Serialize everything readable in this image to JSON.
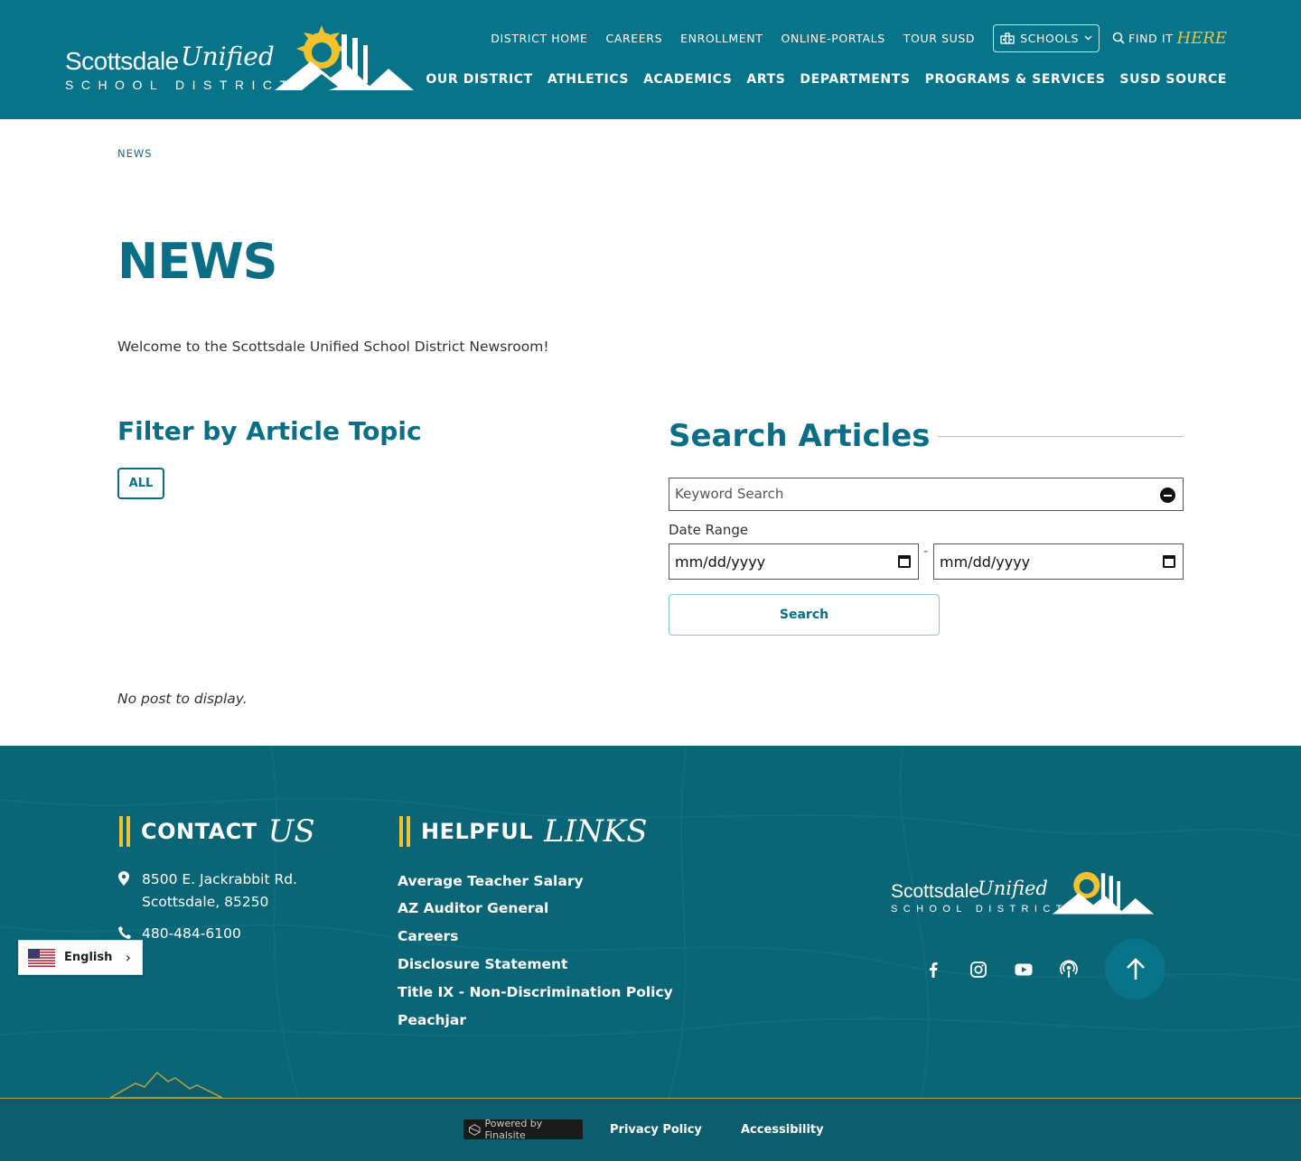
{
  "header": {
    "logo": {
      "word": "Scottsdale",
      "script": "Unified",
      "sub": "SCHOOL DISTRICT"
    },
    "utility_nav": [
      "DISTRICT HOME",
      "CAREERS",
      "ENROLLMENT",
      "ONLINE-PORTALS",
      "TOUR SUSD"
    ],
    "schools_label": "SCHOOLS",
    "find_label": "FIND IT",
    "find_here": "HERE",
    "main_nav": [
      "OUR DISTRICT",
      "ATHLETICS",
      "ACADEMICS",
      "ARTS",
      "DEPARTMENTS",
      "PROGRAMS & SERVICES",
      "SUSD SOURCE"
    ]
  },
  "breadcrumb": "NEWS",
  "page_title": "NEWS",
  "welcome": "Welcome to the Scottsdale Unified School District Newsroom!",
  "filter": {
    "heading": "Filter by Article Topic",
    "all_label": "ALL"
  },
  "search": {
    "heading": "Search Articles",
    "keyword_placeholder": "Keyword Search",
    "date_label": "Date Range",
    "date_from": "mm/dd/yyyy",
    "date_sep": "-",
    "date_to": "mm/dd/yyyy",
    "button_label": "Search"
  },
  "no_post": "No post to display.",
  "footer": {
    "contact": {
      "h1": "CONTACT",
      "h2": "US",
      "address_line1": "8500 E. Jackrabbit Rd.",
      "address_line2": "Scottsdale, 85250",
      "phone": "480-484-6100"
    },
    "links": {
      "h1": "HELPFUL",
      "h2": "LINKS",
      "items": [
        "Average Teacher Salary",
        "AZ Auditor General",
        "Careers",
        "Disclosure Statement",
        "Title IX - Non-Discrimination Policy",
        "Peachjar"
      ]
    },
    "logo": {
      "word": "Scottsdale",
      "script": "Unified",
      "sub": "SCHOOL DISTRICT"
    },
    "social_icons": [
      "facebook-icon",
      "instagram-icon",
      "youtube-icon",
      "podcast-icon"
    ]
  },
  "bottom": {
    "powered_by": "Powered by Finalsite",
    "privacy": "Privacy Policy",
    "accessibility": "Accessibility"
  },
  "language": {
    "label": "English"
  },
  "colors": {
    "brand_teal": "#08748a",
    "heading_teal": "#0a6f86",
    "accent_gold": "#f2c12e",
    "footer_teal": "#0a6576"
  }
}
